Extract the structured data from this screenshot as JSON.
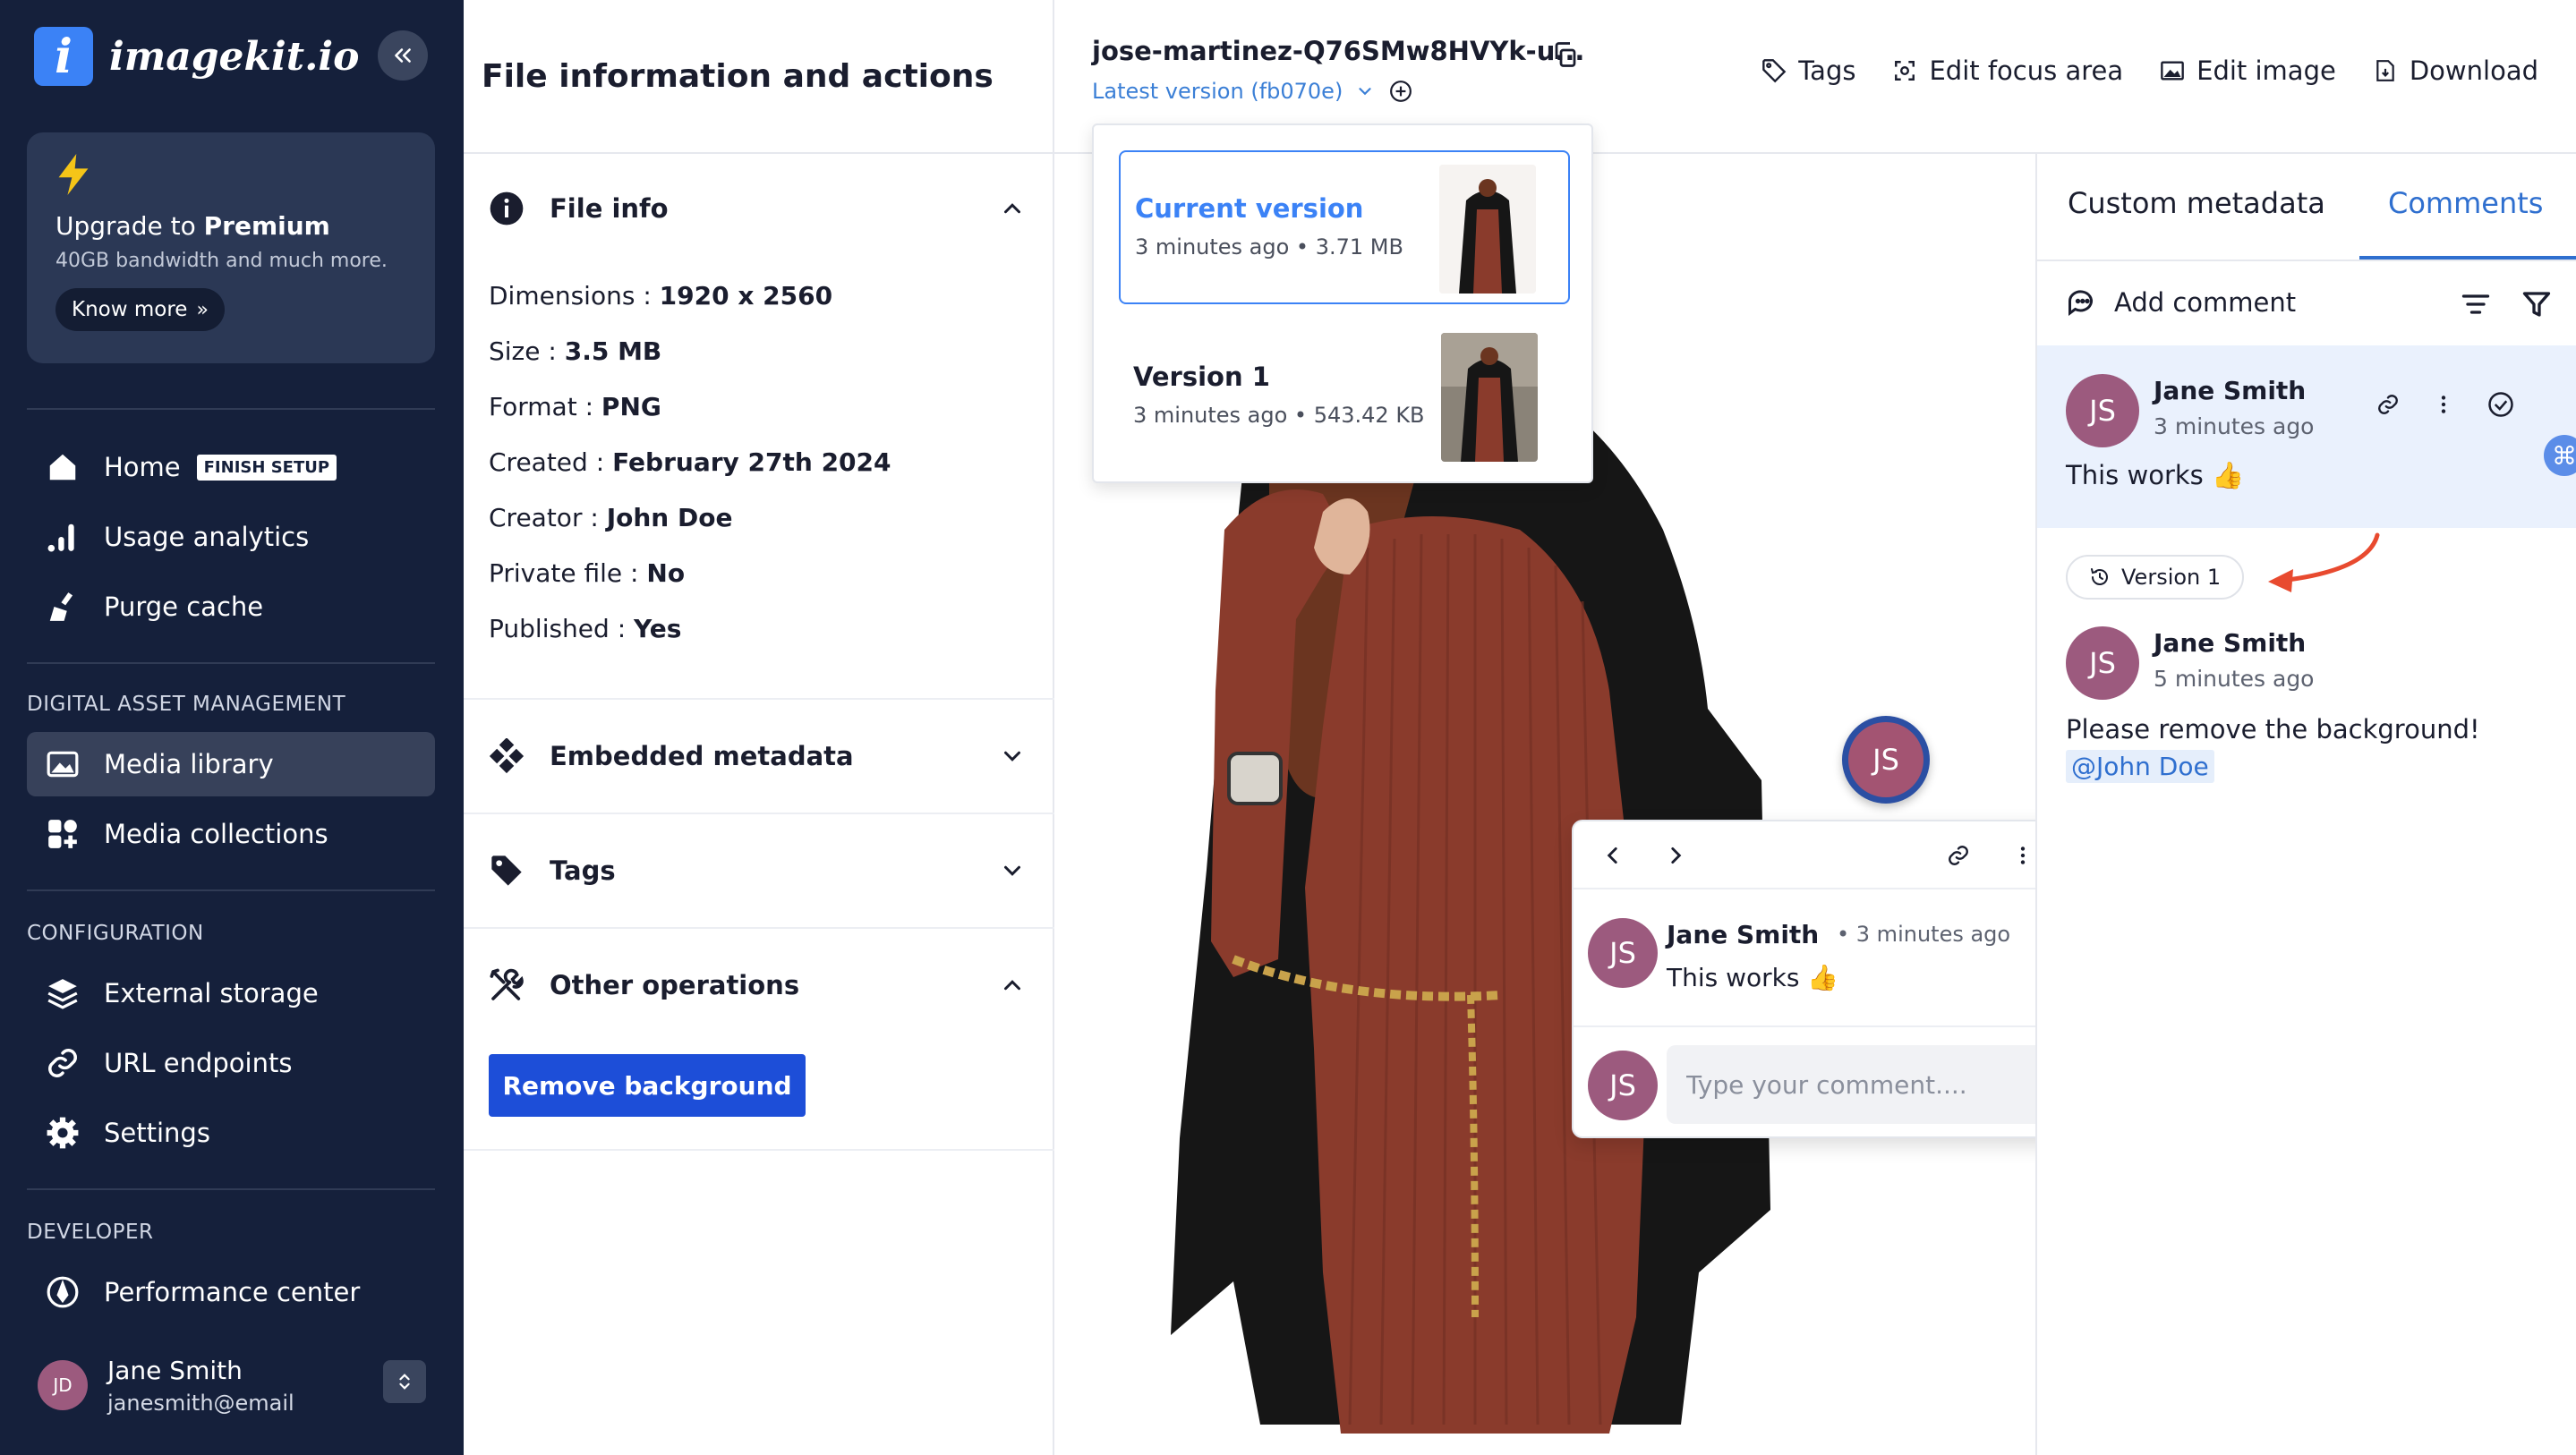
{
  "sidebar": {
    "logo_letter": "i",
    "logo_text": "imagekit.io",
    "upgrade": {
      "title_prefix": "Upgrade to",
      "title_bold": "Premium",
      "subtitle": "40GB bandwidth and much more.",
      "button": "Know more"
    },
    "nav_top": [
      {
        "label": "Home",
        "icon": "home-icon",
        "badge": "FINISH SETUP"
      },
      {
        "label": "Usage analytics",
        "icon": "bar-chart-icon"
      },
      {
        "label": "Purge cache",
        "icon": "broom-icon"
      }
    ],
    "sections": {
      "dam": "DIGITAL ASSET MANAGEMENT",
      "config": "CONFIGURATION",
      "developer": "DEVELOPER"
    },
    "nav_dam": [
      {
        "label": "Media library",
        "icon": "image-icon",
        "active": true
      },
      {
        "label": "Media collections",
        "icon": "collections-icon"
      }
    ],
    "nav_config": [
      {
        "label": "External storage",
        "icon": "layers-icon"
      },
      {
        "label": "URL endpoints",
        "icon": "link-icon"
      },
      {
        "label": "Settings",
        "icon": "gear-icon"
      }
    ],
    "nav_dev": [
      {
        "label": "Performance center",
        "icon": "gauge-icon"
      }
    ],
    "user": {
      "initials": "JD",
      "name": "Jane Smith",
      "email": "janesmith@email"
    }
  },
  "info_panel": {
    "title": "File information and actions",
    "file_info": {
      "heading": "File info",
      "rows": [
        {
          "key": "Dimensions :",
          "value": "1920 x 2560"
        },
        {
          "key": "Size :",
          "value": "3.5 MB"
        },
        {
          "key": "Format :",
          "value": "PNG"
        },
        {
          "key": "Created :",
          "value": "February 27th 2024"
        },
        {
          "key": "Creator :",
          "value": "John Doe"
        },
        {
          "key": "Private file :",
          "value": "No"
        },
        {
          "key": "Published :",
          "value": "Yes"
        }
      ]
    },
    "embedded_metadata": "Embedded metadata",
    "tags": "Tags",
    "other_operations": "Other operations",
    "remove_background": "Remove background"
  },
  "topbar": {
    "filename": "jose-martinez-Q76SMw8HVYk-u...",
    "version_label": "Latest version (fb070e)",
    "actions": {
      "tags": "Tags",
      "focus": "Edit focus area",
      "edit": "Edit image",
      "download": "Download"
    }
  },
  "versions": [
    {
      "title": "Current version",
      "meta": "3 minutes ago • 3.71 MB"
    },
    {
      "title": "Version 1",
      "meta": "3 minutes ago • 543.42 KB"
    }
  ],
  "pin": {
    "initials": "JS"
  },
  "popup": {
    "initials": "JS",
    "name": "Jane Smith",
    "time": "• 3 minutes ago",
    "text": "This works 👍",
    "reply_initials": "JS",
    "input_placeholder": "Type your comment...."
  },
  "right_panel": {
    "tabs": [
      "Custom metadata",
      "Comments"
    ],
    "active_tab": "Comments",
    "add_comment": "Add comment",
    "comments": [
      {
        "initials": "JS",
        "name": "Jane Smith",
        "time": "3 minutes ago",
        "text": "This works 👍"
      },
      {
        "initials": "JS",
        "name": "Jane Smith",
        "time": "5 minutes ago",
        "text": "Please remove the background!",
        "mention": "@John Doe"
      }
    ],
    "version_chip": "Version 1"
  },
  "colors": {
    "sidebar_bg": "#15203b",
    "accent": "#3b82f6",
    "primary_button": "#1d4ed8",
    "avatar": "#9c5a7e",
    "arrow": "#e84a2f"
  }
}
